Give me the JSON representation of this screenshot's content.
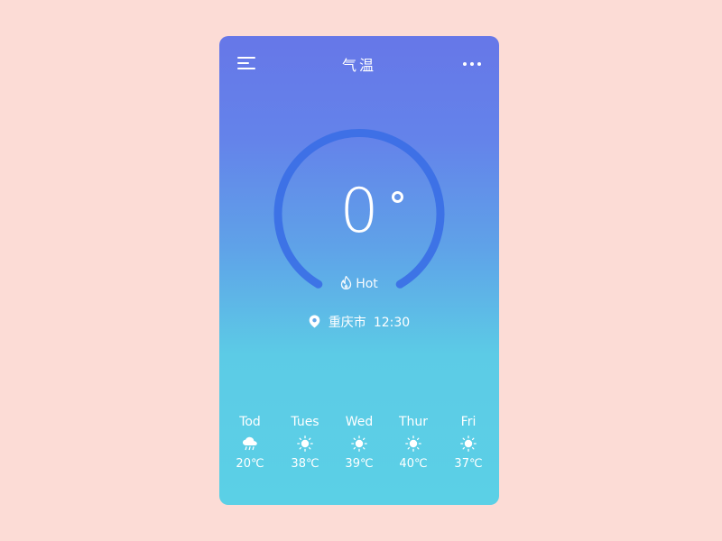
{
  "header": {
    "title": "气温",
    "menu_icon": "menu-icon",
    "more_icon": "more-dots-icon"
  },
  "gauge": {
    "current_temp": "0",
    "unit_symbol": "°",
    "status_label": "Hot",
    "status_icon": "flame-icon",
    "arc_color": "#3a6ee6"
  },
  "location": {
    "icon": "location-pin-icon",
    "city": "重庆市",
    "time": "12:30"
  },
  "forecast": [
    {
      "day": "Tod",
      "icon": "cloud-rain-icon",
      "temp": "20℃"
    },
    {
      "day": "Tues",
      "icon": "sun-icon",
      "temp": "38℃"
    },
    {
      "day": "Wed",
      "icon": "sun-icon",
      "temp": "39℃"
    },
    {
      "day": "Thur",
      "icon": "sun-icon",
      "temp": "40℃"
    },
    {
      "day": "Fri",
      "icon": "sun-icon",
      "temp": "37℃"
    }
  ],
  "colors": {
    "page_background": "#fcdcd6",
    "card_top": "#6677e8",
    "card_bottom": "#5bd0e6",
    "text": "#ffffff"
  }
}
